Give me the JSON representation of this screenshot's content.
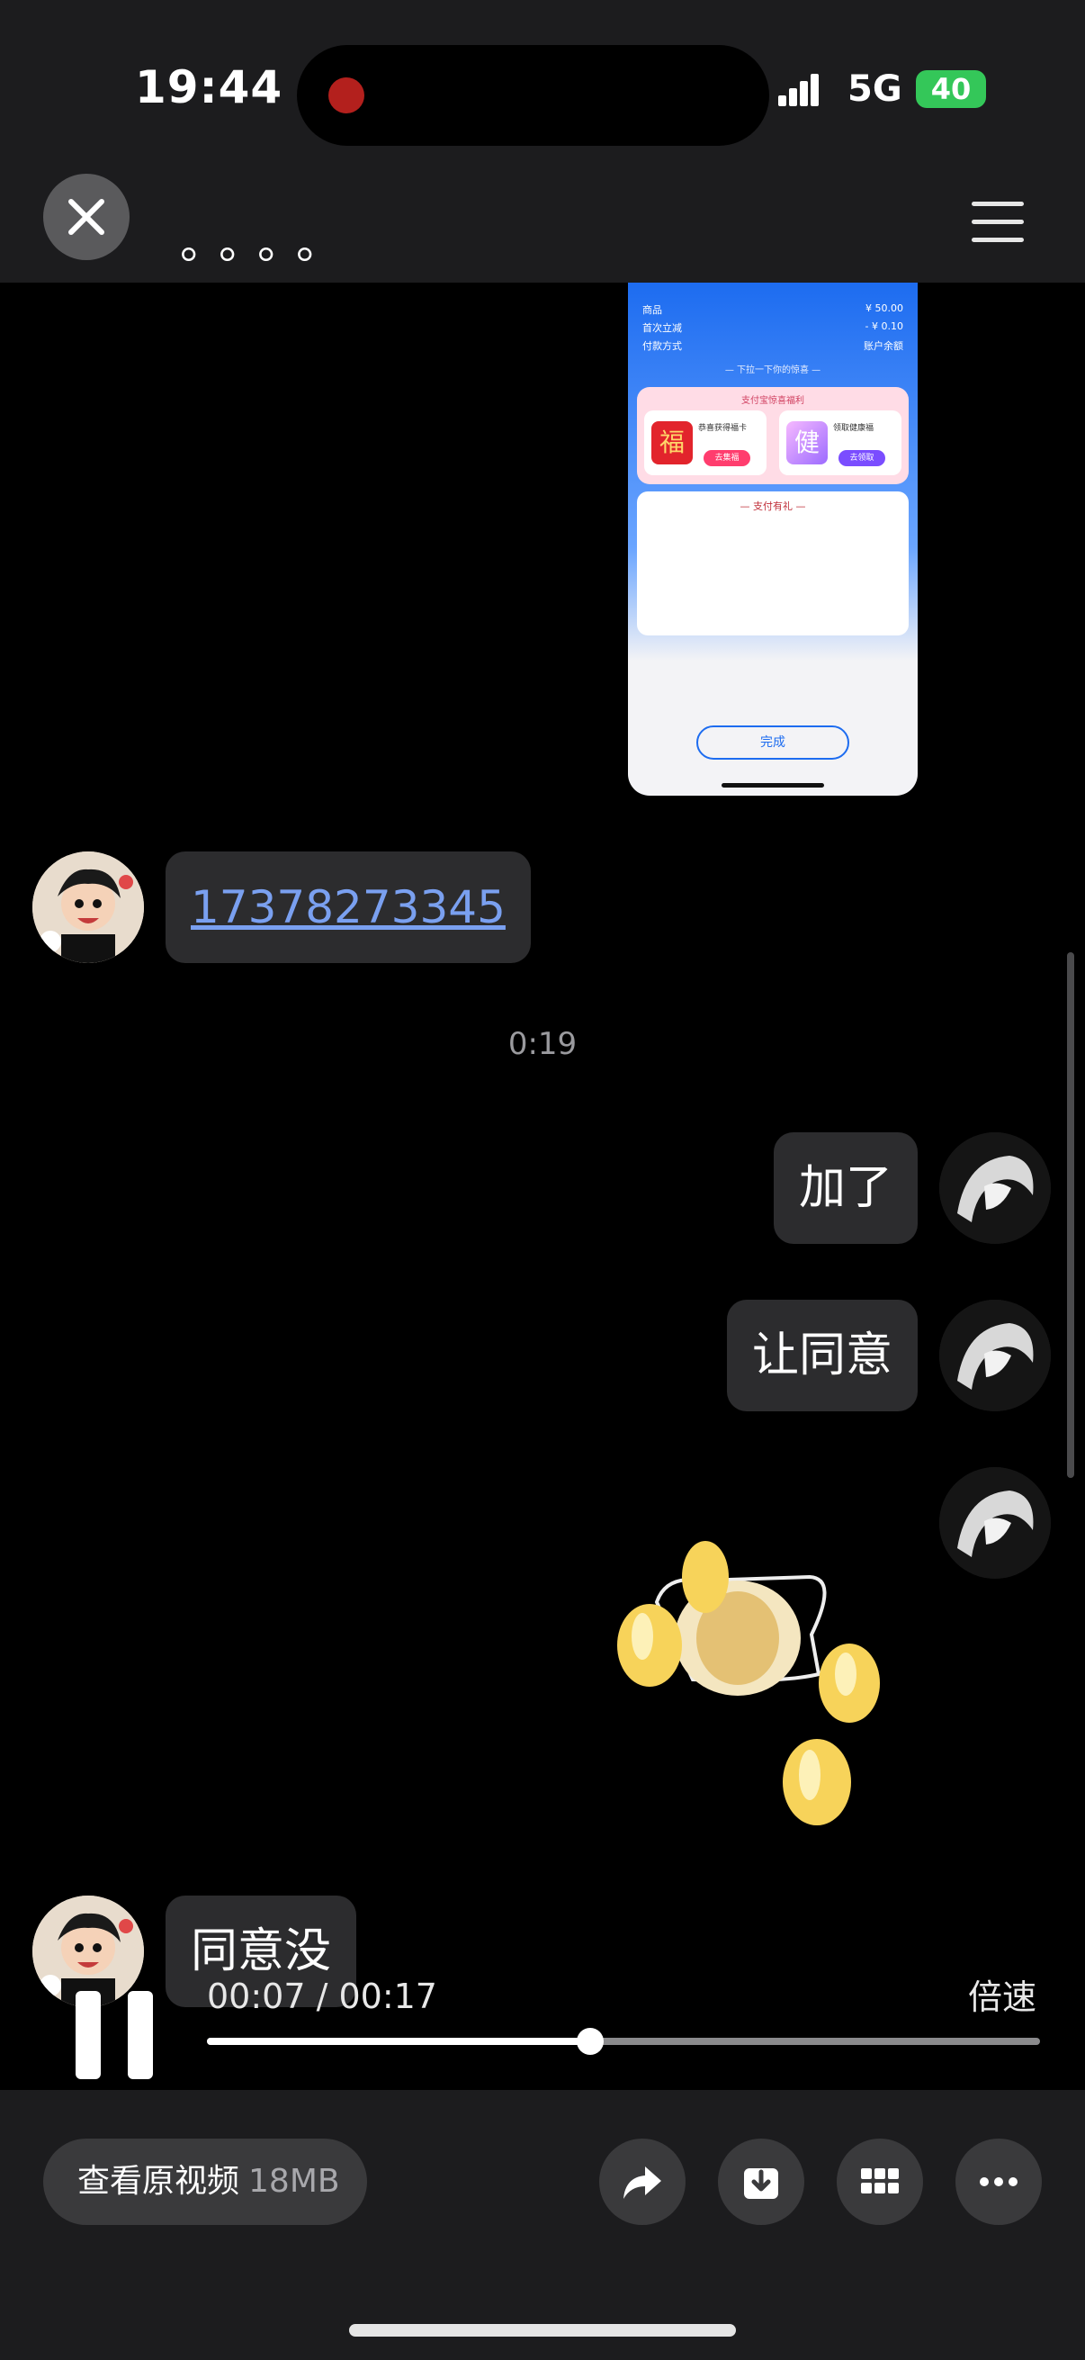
{
  "status_bar": {
    "time": "19:44",
    "network": "5G",
    "battery": "40"
  },
  "header": {
    "title": "。。。。",
    "close_icon": "close-icon",
    "menu_icon": "hamburger-menu-icon"
  },
  "screenshot": {
    "rows": [
      {
        "label": "商品",
        "value": "¥ 50.00"
      },
      {
        "label": "首次立减",
        "value": "- ¥ 0.10"
      },
      {
        "label": "付款方式",
        "value": "账户余额"
      }
    ],
    "subtitle": "— 下拉一下你的惊喜 —",
    "card_title": "支付宝惊喜福利",
    "card_left_text": "恭喜获得福卡",
    "card_left_icon": "福",
    "card_left_button": "去集福",
    "card_right_text": "领取健康福",
    "card_right_icon": "健",
    "card_right_button": "去领取",
    "gift_title": "— 支付有礼 —",
    "done_button": "完成"
  },
  "messages": [
    {
      "side": "left",
      "text": "17378273345",
      "type": "link"
    },
    {
      "side": "system",
      "text": "0:19"
    },
    {
      "side": "right",
      "text": "加了"
    },
    {
      "side": "right",
      "text": "让同意"
    },
    {
      "side": "right",
      "type": "sticker",
      "sticker_icon": "panda-waving-hands-sticker"
    },
    {
      "side": "left",
      "text": "同意没"
    }
  ],
  "video": {
    "current_time": "00:07",
    "total_time": "00:17",
    "time_display": "00:07 / 00:17",
    "progress": 0.46,
    "speed_label": "倍速",
    "pause_icon": "pause-icon"
  },
  "toolbar": {
    "view_original_label": "查看原视频",
    "view_original_size": "18MB",
    "icons": [
      "share-icon",
      "download-icon",
      "grid-icon",
      "more-icon"
    ]
  },
  "colors": {
    "bubble": "#2c2c2e",
    "link": "#7aa0f0",
    "background": "#000000",
    "battery": "#34c759"
  }
}
